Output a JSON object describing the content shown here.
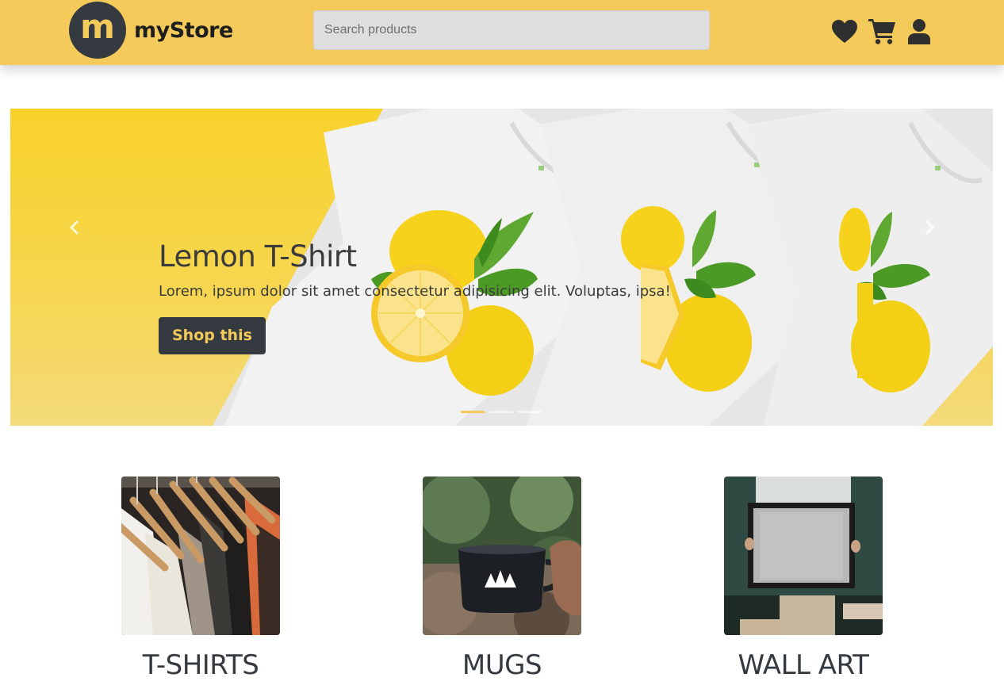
{
  "brand": {
    "logo_letter": "m",
    "name": "myStore"
  },
  "search": {
    "placeholder": "Search products",
    "value": ""
  },
  "nav_icons": [
    "heart-icon",
    "cart-icon",
    "user-icon"
  ],
  "carousel": {
    "title": "Lemon T-Shirt",
    "description": "Lorem, ipsum dolor sit amet consectetur adipisicing elit. Voluptas, ipsa!",
    "button_label": "Shop this",
    "slide_count": 3,
    "active_slide": 1
  },
  "categories": [
    {
      "label": "T-SHIRTS"
    },
    {
      "label": "MUGS"
    },
    {
      "label": "WALL ART"
    }
  ],
  "colors": {
    "brand_yellow": "#f4cb5b",
    "dark": "#343a40"
  }
}
